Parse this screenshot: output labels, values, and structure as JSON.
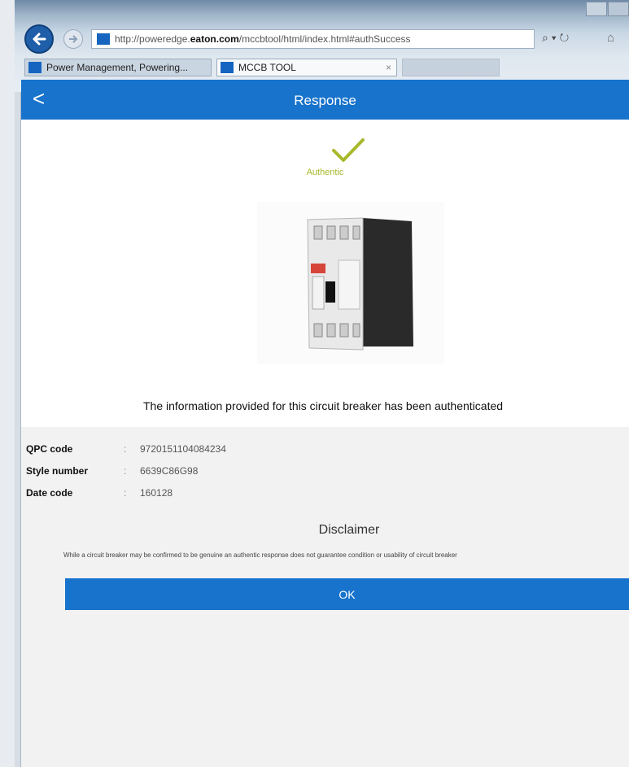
{
  "browser": {
    "url_prefix": "http://poweredge.",
    "url_domain": "eaton.com",
    "url_path": "/mccbtool/html/index.html#authSuccess",
    "search_glyph": "⌕ ▾ ↻",
    "home_glyph": "⌂",
    "tabs": [
      {
        "label": "Power Management, Powering..."
      },
      {
        "label": "MCCB TOOL",
        "close": "×"
      }
    ]
  },
  "app": {
    "header_title": "Response",
    "back_glyph": "<",
    "status_text": "Authentic",
    "accent_color": "#1873cc",
    "status_color": "#a9b82c",
    "info_line": "The information provided for this circuit breaker has been authenticated",
    "details": [
      {
        "label": "QPC code",
        "sep": ":",
        "value": "9720151104084234"
      },
      {
        "label": "Style number",
        "sep": ":",
        "value": "6639C86G98"
      },
      {
        "label": "Date code",
        "sep": ":",
        "value": "160128"
      }
    ],
    "disclaimer_title": "Disclaimer",
    "disclaimer_text": "While a circuit breaker may be confirmed to be genuine an authentic response does not guarantee condition or usability of circuit breaker",
    "ok_label": "OK"
  }
}
